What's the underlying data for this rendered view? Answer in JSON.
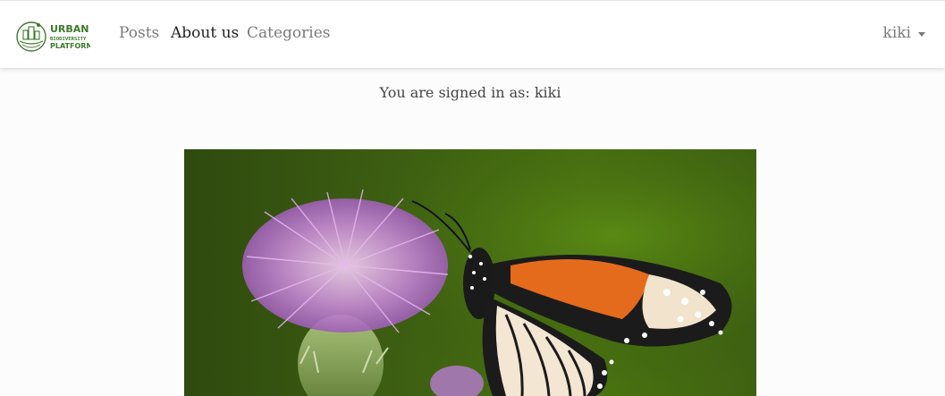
{
  "brand": {
    "line1": "URBAN",
    "line2": "BIODIVERSITY",
    "line3": "PLATFORM",
    "color": "#3b7a2a"
  },
  "nav": {
    "items": [
      {
        "label": "Posts"
      },
      {
        "label": "About us"
      },
      {
        "label": "Categories"
      }
    ]
  },
  "user_menu": {
    "username": "kiki"
  },
  "main": {
    "signed_in_text": "You are signed in as: kiki"
  },
  "hero": {
    "icon": "monarch-butterfly-on-thistle-photo"
  }
}
